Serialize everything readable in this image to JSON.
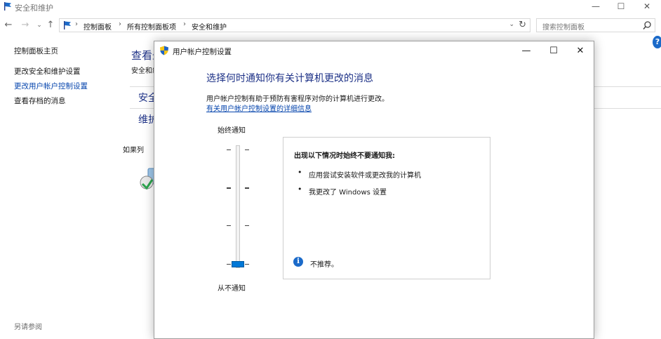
{
  "main_window": {
    "title": "安全和维护",
    "controls": {
      "minimize": "—",
      "maximize": "☐",
      "close": "✕"
    }
  },
  "navigation": {
    "back": "←",
    "forward": "→",
    "recent": "⌄",
    "up": "↑",
    "breadcrumbs": [
      "控制面板",
      "所有控制面板项",
      "安全和维护"
    ],
    "separator": "›",
    "dropdown": "⌄",
    "refresh": "↻",
    "search_placeholder": "搜索控制面板"
  },
  "sidebar": {
    "items": [
      {
        "label": "控制面板主页"
      },
      {
        "label": "更改安全和维护设置"
      },
      {
        "label": "更改用户帐户控制设置"
      },
      {
        "label": "查看存档的消息"
      }
    ],
    "see_also": "另请参阅"
  },
  "main": {
    "heading": "查看最",
    "subheading": "安全和维",
    "sections": [
      "安全",
      "维护"
    ],
    "if_listed": "如果列",
    "help": "?"
  },
  "uac_dialog": {
    "title": "用户帐户控制设置",
    "controls": {
      "minimize": "—",
      "maximize": "☐",
      "close": "✕"
    },
    "heading": "选择何时通知你有关计算机更改的消息",
    "description": "用户帐户控制有助于预防有害程序对你的计算机进行更改。",
    "link": "有关用户帐户控制设置的详细信息",
    "slider": {
      "top_label": "始终通知",
      "bottom_label": "从不通知",
      "levels": 4,
      "selected_level": 1
    },
    "panel": {
      "title": "出现以下情况时始终不要通知我:",
      "bullets": [
        "应用尝试安装软件或更改我的计算机",
        "我更改了 Windows 设置"
      ],
      "bullet_glyph": "•",
      "note": "不推荐。",
      "note_icon": "i"
    }
  },
  "colors": {
    "accent": "#0078d7",
    "heading": "#1e3287",
    "link": "#0645ad"
  }
}
